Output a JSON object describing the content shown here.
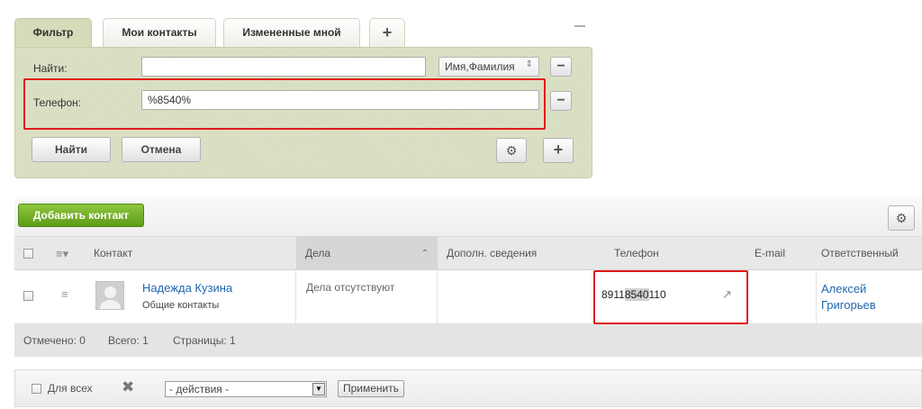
{
  "filter": {
    "tabs": [
      {
        "label": "Фильтр"
      },
      {
        "label": "Мои контакты"
      },
      {
        "label": "Измененные мной"
      }
    ],
    "add_tab_glyph": "+",
    "find_label": "Найти:",
    "find_value": "",
    "find_field_select": "Имя,Фамилия",
    "phone_label": "Телефон:",
    "phone_value": "%8540%",
    "remove_glyph": "−",
    "submit_label": "Найти",
    "cancel_label": "Отмена",
    "add_field_glyph": "+"
  },
  "grid": {
    "add_contact_label": "Добавить контакт",
    "columns": [
      "Контакт",
      "Дела",
      "Дополн. сведения",
      "Телефон",
      "E-mail",
      "Ответственный"
    ],
    "rows": [
      {
        "contact_name": "Надежда Кузина",
        "contact_type": "Общие контакты",
        "tasks": "Дела отсутствуют",
        "extra": "",
        "phone_prefix": "8911",
        "phone_match": "8540",
        "phone_suffix": "110",
        "email": "",
        "responsible": "Алексей Григорьев"
      }
    ],
    "footer": {
      "selected": "Отмечено: 0",
      "total": "Всего: 1",
      "pages": "Страницы:  1"
    }
  },
  "actions": {
    "for_all_label": "Для всех",
    "select_value": "- действия -",
    "apply_label": "Применить"
  },
  "colors": {
    "filter_bg": "#d7ddbf",
    "accent_green": "#6aa821",
    "highlight_red": "#e11a1a",
    "link_blue": "#2067b0"
  },
  "icons": [
    "plus-icon",
    "minus-icon",
    "gear-icon",
    "menu-icon",
    "sort-up-icon",
    "call-icon",
    "delete-x-icon",
    "dropdown-arrow-icon"
  ]
}
